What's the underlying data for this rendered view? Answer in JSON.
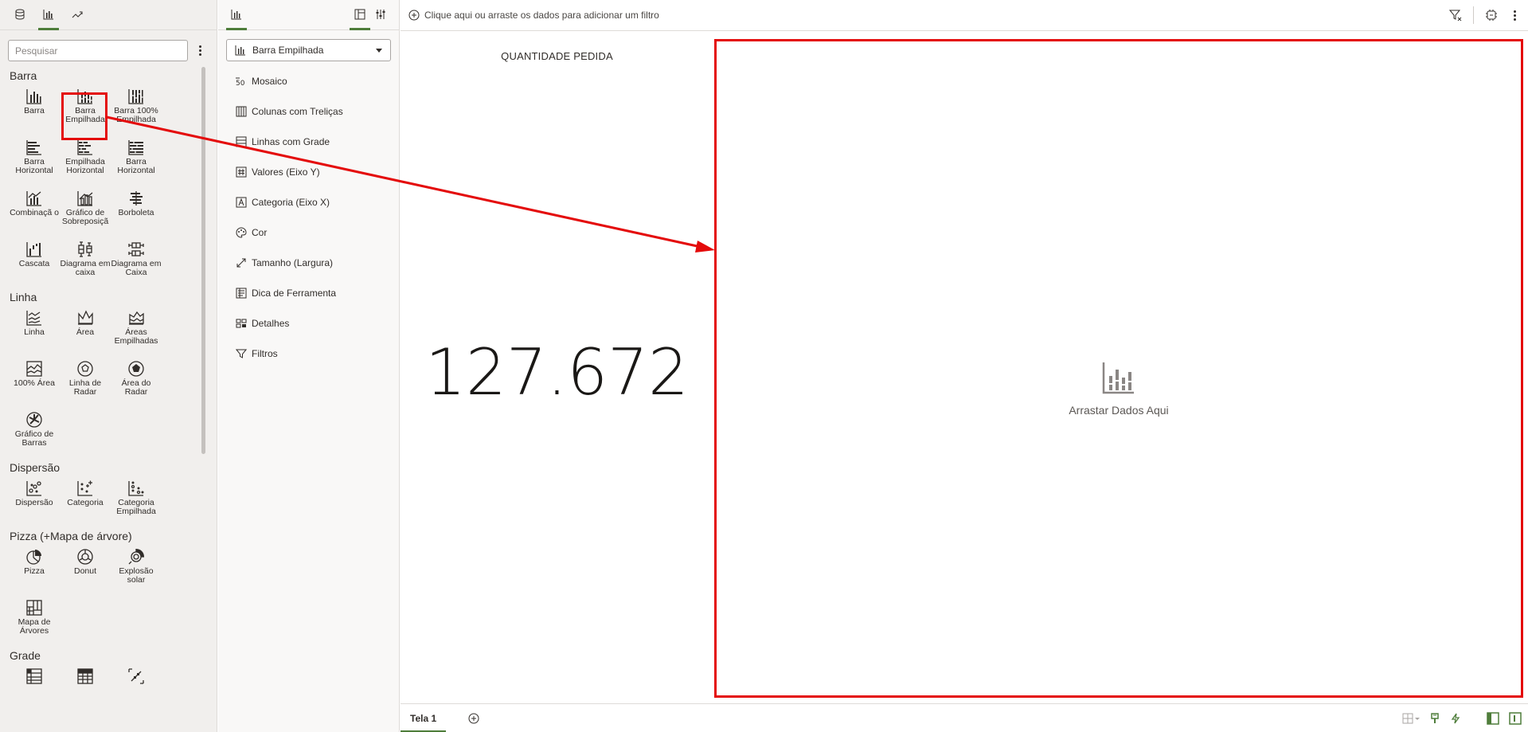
{
  "left_panel": {
    "tabs": [
      {
        "icon": "database-icon"
      },
      {
        "icon": "bar-chart-icon",
        "active": true
      },
      {
        "icon": "trend-arrow-icon"
      }
    ],
    "search_placeholder": "Pesquisar",
    "groups": [
      {
        "title": "Barra",
        "items": [
          {
            "label": "Barra",
            "icon": "bar-icon"
          },
          {
            "label": "Barra Empilhada",
            "icon": "stacked-bar-icon"
          },
          {
            "label": "Barra 100% Empilhada",
            "icon": "bar-100-stacked-icon"
          },
          {
            "label": "Barra Horizontal",
            "icon": "horizontal-bar-icon"
          },
          {
            "label": "Empilhada Horizontal",
            "icon": "horizontal-stacked-icon"
          },
          {
            "label": "Barra Horizontal",
            "icon": "horizontal-bar-100-icon"
          },
          {
            "label": "Combinaçã o",
            "icon": "combo-icon"
          },
          {
            "label": "Gráfico de Sobreposiçã",
            "icon": "overlay-icon"
          },
          {
            "label": "Borboleta",
            "icon": "butterfly-icon"
          },
          {
            "label": "Cascata",
            "icon": "waterfall-icon"
          },
          {
            "label": "Diagrama em caixa",
            "icon": "boxplot-icon"
          },
          {
            "label": "Diagrama em Caixa",
            "icon": "boxplot-horizontal-icon"
          }
        ]
      },
      {
        "title": "Linha",
        "items": [
          {
            "label": "Linha",
            "icon": "line-icon"
          },
          {
            "label": "Área",
            "icon": "area-icon"
          },
          {
            "label": "Áreas Empilhadas",
            "icon": "stacked-area-icon"
          },
          {
            "label": "100% Área",
            "icon": "area-100-icon"
          },
          {
            "label": "Linha de Radar",
            "icon": "radar-line-icon"
          },
          {
            "label": "Área do Radar",
            "icon": "radar-area-icon"
          },
          {
            "label": "Gráfico de Barras",
            "icon": "radar-bar-icon"
          }
        ]
      },
      {
        "title": "Dispersão",
        "items": [
          {
            "label": "Dispersão",
            "icon": "scatter-icon"
          },
          {
            "label": "Categoria",
            "icon": "category-scatter-icon"
          },
          {
            "label": "Categoria Empilhada",
            "icon": "stacked-category-icon"
          }
        ]
      },
      {
        "title": "Pizza (+Mapa de árvore)",
        "items": [
          {
            "label": "Pizza",
            "icon": "pie-icon"
          },
          {
            "label": "Donut",
            "icon": "donut-icon"
          },
          {
            "label": "Explosão solar",
            "icon": "sunburst-icon"
          },
          {
            "label": "Mapa de Árvores",
            "icon": "treemap-icon"
          }
        ]
      },
      {
        "title": "Grade",
        "items": [
          {
            "label": "",
            "icon": "pivot-icon"
          },
          {
            "label": "",
            "icon": "table-icon"
          },
          {
            "label": "",
            "icon": "heatmap-icon"
          }
        ]
      }
    ]
  },
  "grammar_panel": {
    "selected_viz": "Barra Empilhada",
    "rows": [
      {
        "label": "Mosaico",
        "icon": "trellis-icon"
      },
      {
        "label": "Colunas com Treliças",
        "icon": "trellis-columns-icon"
      },
      {
        "label": "Linhas com Grade",
        "icon": "trellis-rows-icon"
      },
      {
        "label": "Valores (Eixo Y)",
        "icon": "hash-icon"
      },
      {
        "label": "Categoria (Eixo X)",
        "icon": "letter-a-icon"
      },
      {
        "label": "Cor",
        "icon": "palette-icon"
      },
      {
        "label": "Tamanho (Largura)",
        "icon": "resize-icon"
      },
      {
        "label": "Dica de Ferramenta",
        "icon": "tooltip-icon"
      },
      {
        "label": "Detalhes",
        "icon": "details-icon"
      },
      {
        "label": "Filtros",
        "icon": "filter-icon"
      }
    ]
  },
  "filter_bar": {
    "hint": "Clique aqui ou arraste os dados para adicionar um filtro"
  },
  "canvas": {
    "tile_title": "QUANTIDADE PEDIDA",
    "tile_value": "127.672",
    "drop_label": "Arrastar Dados Aqui"
  },
  "bottom": {
    "canvas_tab": "Tela 1"
  },
  "colors": {
    "accent_green": "#4e7d3a",
    "annotation_red": "#e40b0b",
    "panel_bg": "#f1efed"
  }
}
